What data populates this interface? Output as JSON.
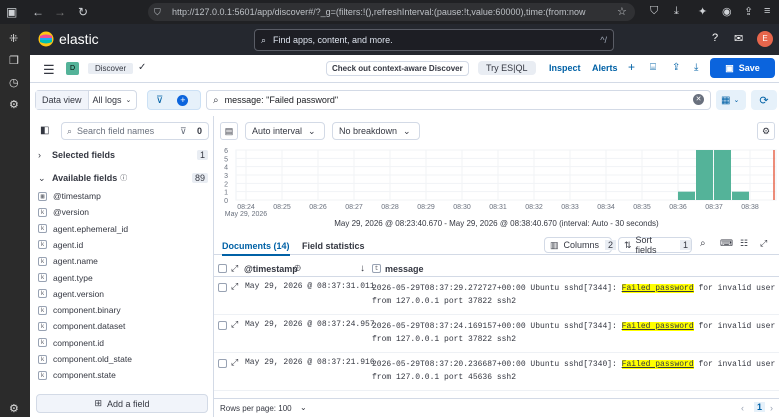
{
  "browser": {
    "url": "http://127.0.0.1:5601/app/discover#/?_g=(filters:!(),refreshInterval:(pause:!t,value:60000),time:(from:now"
  },
  "header": {
    "brand": "elastic",
    "search_placeholder": "Find apps, content, and more.",
    "search_shortcut": "^/",
    "avatar": "E"
  },
  "toolbar": {
    "badge": "D",
    "breadcrumb": "Discover",
    "promo": "Check out context-aware Discover",
    "try_esql": "Try ES|QL",
    "inspect": "Inspect",
    "alerts": "Alerts",
    "save": "Save"
  },
  "query": {
    "data_view_label": "Data view",
    "data_view_value": "All logs",
    "text": "message: \"Failed password\""
  },
  "fields": {
    "search_placeholder": "Search field names",
    "filter_count": "0",
    "selected_label": "Selected fields",
    "selected_count": "1",
    "available_label": "Available fields",
    "available_count": "89",
    "items": [
      {
        "type": "cal",
        "name": "@timestamp"
      },
      {
        "type": "k",
        "name": "@version"
      },
      {
        "type": "k",
        "name": "agent.ephemeral_id"
      },
      {
        "type": "k",
        "name": "agent.id"
      },
      {
        "type": "k",
        "name": "agent.name"
      },
      {
        "type": "k",
        "name": "agent.type"
      },
      {
        "type": "k",
        "name": "agent.version"
      },
      {
        "type": "k",
        "name": "component.binary"
      },
      {
        "type": "k",
        "name": "component.dataset"
      },
      {
        "type": "k",
        "name": "component.id"
      },
      {
        "type": "k",
        "name": "component.old_state"
      },
      {
        "type": "k",
        "name": "component.state"
      }
    ],
    "add_field": "Add a field"
  },
  "histogram_controls": {
    "interval": "Auto interval",
    "breakdown": "No breakdown"
  },
  "chart_data": {
    "type": "bar",
    "yticks": [
      "6",
      "5",
      "4",
      "3",
      "2",
      "1",
      "0"
    ],
    "ylim": [
      0,
      6
    ],
    "categories": [
      "08:24",
      "08:25",
      "08:26",
      "08:27",
      "08:28",
      "08:29",
      "08:30",
      "08:31",
      "08:32",
      "08:33",
      "08:34",
      "08:35",
      "08:36",
      "08:37",
      "08:38"
    ],
    "x_sublabel": "May 29, 2026",
    "bars": [
      {
        "time": "08:36:00",
        "value": 1
      },
      {
        "time": "08:36:30",
        "value": 6
      },
      {
        "time": "08:37:00",
        "value": 6
      },
      {
        "time": "08:37:30",
        "value": 1
      }
    ],
    "range_text": "May 29, 2026 @ 08:23:40.670 - May 29, 2026 @ 08:38:40.670 (interval: Auto - 30 seconds)"
  },
  "tabs": {
    "documents": "Documents (14)",
    "field_stats": "Field statistics"
  },
  "grid": {
    "columns_label": "Columns",
    "columns_count": "2",
    "sort_label": "Sort fields",
    "sort_count": "1",
    "col_timestamp": "@timestamp",
    "col_message": "message",
    "rows": [
      {
        "time": "May 29, 2026 @ 08:37:31.011",
        "pre": "2026-05-29T08:37:29.272727+00:00 Ubuntu sshd[7344]: ",
        "hl": "Failed password",
        "post": " for invalid user fakeuser",
        "line2": "from 127.0.0.1 port 37822 ssh2"
      },
      {
        "time": "May 29, 2026 @ 08:37:24.957",
        "pre": "2026-05-29T08:37:24.169157+00:00 Ubuntu sshd[7344]: ",
        "hl": "Failed password",
        "post": " for invalid user fakeuser",
        "line2": "from 127.0.0.1 port 37822 ssh2"
      },
      {
        "time": "May 29, 2026 @ 08:37:21.916",
        "pre": "2026-05-29T08:37:20.236687+00:00 Ubuntu sshd[7340]: ",
        "hl": "Failed password",
        "post": " for invalid user fakeuser",
        "line2": "from 127.0.0.1 port 45636 ssh2"
      }
    ],
    "rows_per_page": "Rows per page: 100",
    "page": "1"
  }
}
